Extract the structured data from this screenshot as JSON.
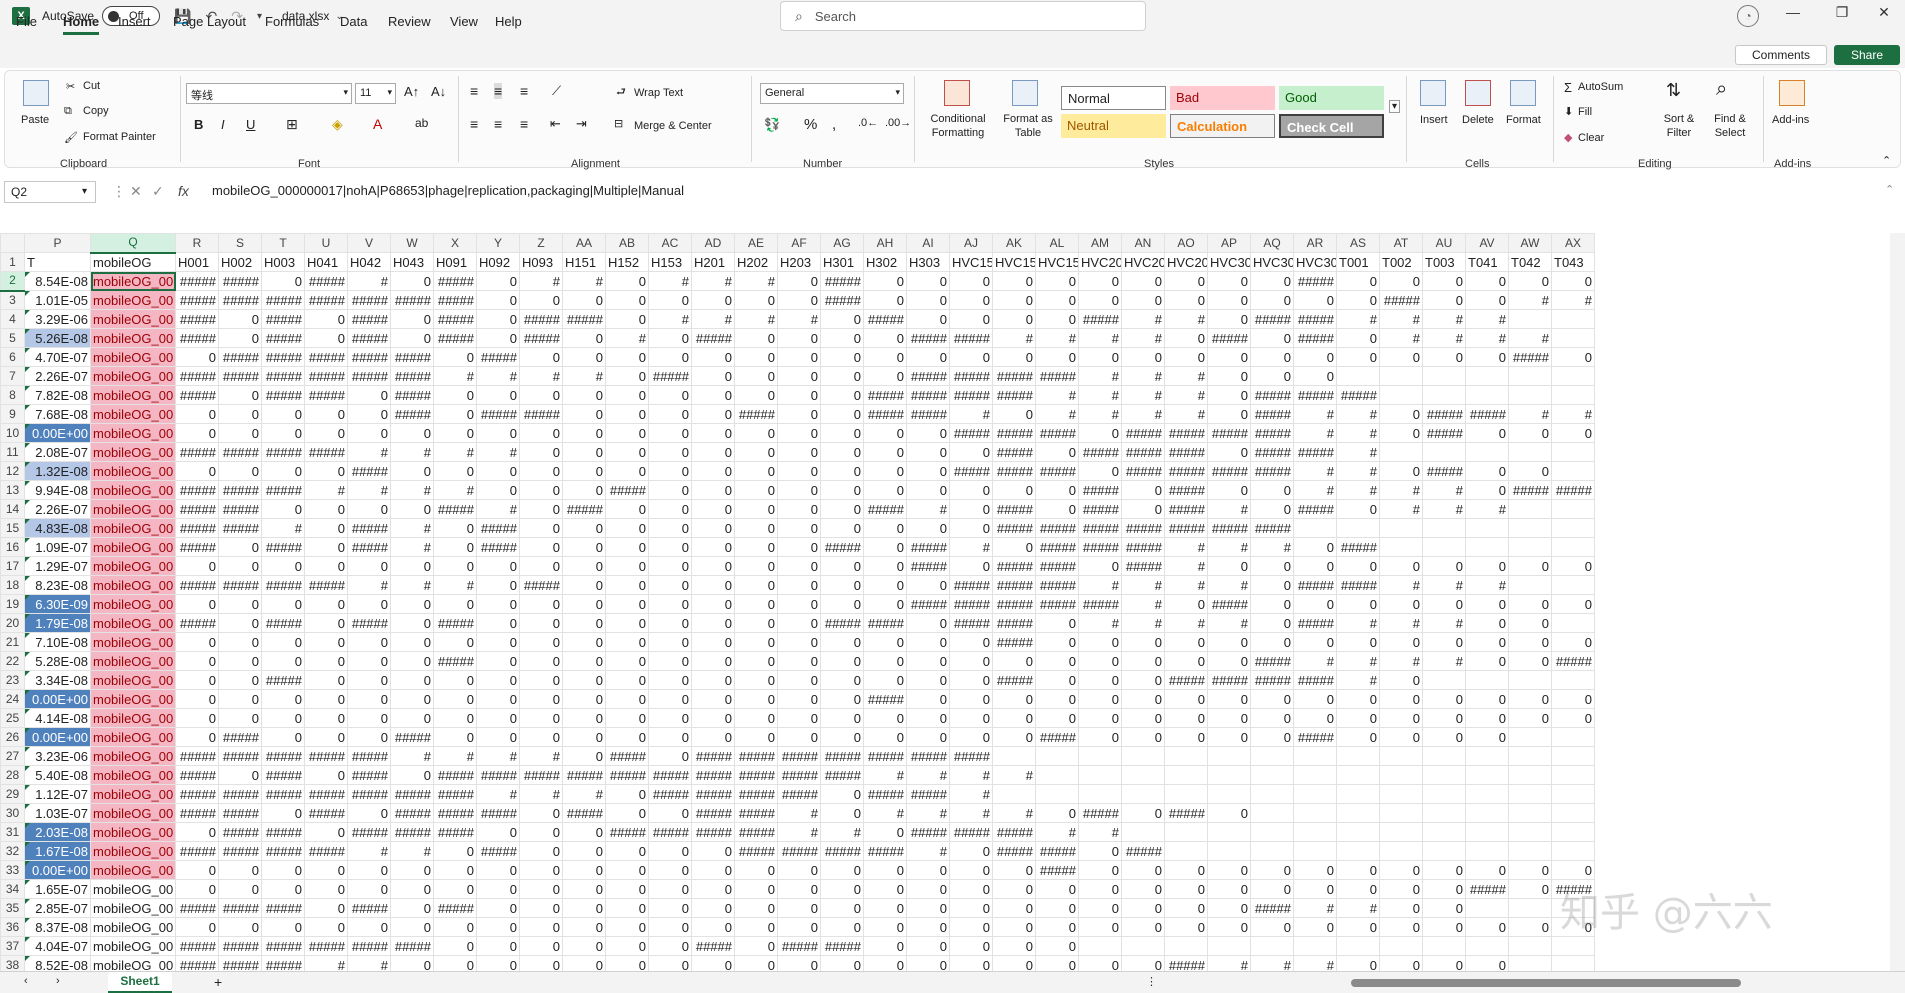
{
  "titlebar": {
    "autosave_label": "AutoSave",
    "autosave_state": "Off",
    "filename": "data.xlsx",
    "search_placeholder": "Search"
  },
  "menu": {
    "tabs": [
      "File",
      "Home",
      "Insert",
      "Page Layout",
      "Formulas",
      "Data",
      "Review",
      "View",
      "Help"
    ],
    "active": "Home",
    "comments_label": "Comments",
    "share_label": "Share"
  },
  "ribbon": {
    "clipboard": {
      "paste": "Paste",
      "cut": "Cut",
      "copy": "Copy",
      "format_painter": "Format Painter",
      "label": "Clipboard"
    },
    "font": {
      "name": "等线",
      "size": "11",
      "label": "Font"
    },
    "alignment": {
      "wrap_text": "Wrap Text",
      "merge_center": "Merge & Center",
      "label": "Alignment"
    },
    "number": {
      "format": "General",
      "label": "Number"
    },
    "styles": {
      "conditional": "Conditional Formatting",
      "format_table": "Format as Table",
      "normal": "Normal",
      "bad": "Bad",
      "good": "Good",
      "neutral": "Neutral",
      "calculation": "Calculation",
      "check_cell": "Check Cell",
      "label": "Styles"
    },
    "cells": {
      "insert": "Insert",
      "delete": "Delete",
      "format": "Format",
      "label": "Cells"
    },
    "editing": {
      "autosum": "AutoSum",
      "fill": "Fill",
      "clear": "Clear",
      "sort_filter": "Sort & Filter",
      "find_select": "Find & Select",
      "label": "Editing"
    },
    "addins": {
      "addins": "Add-ins",
      "label": "Add-ins"
    }
  },
  "formula_bar": {
    "name_box": "Q2",
    "formula": "mobileOG_000000017|nohA|P68653|phage|replication,packaging|Multiple|Manual"
  },
  "grid": {
    "columns": [
      "P",
      "Q",
      "R",
      "S",
      "T",
      "U",
      "V",
      "W",
      "X",
      "Y",
      "Z",
      "AA",
      "AB",
      "AC",
      "AD",
      "AE",
      "AF",
      "AG",
      "AH",
      "AI",
      "AJ",
      "AK",
      "AL",
      "AM",
      "AN",
      "AO",
      "AP",
      "AQ",
      "AR",
      "AS",
      "AT",
      "AU",
      "AV",
      "AW",
      "AX"
    ],
    "selected_column": "Q",
    "header_row": [
      "T",
      "mobileOG",
      "H001",
      "H002",
      "H003",
      "H041",
      "H042",
      "H043",
      "H091",
      "H092",
      "H093",
      "H151",
      "H152",
      "H153",
      "H201",
      "H202",
      "H203",
      "H301",
      "H302",
      "H303",
      "HVC151",
      "HVC152",
      "HVC153",
      "HVC201",
      "HVC202",
      "HVC203",
      "HVC301",
      "HVC302",
      "HVC303",
      "T001",
      "T002",
      "T003",
      "T041",
      "T042",
      "T043"
    ],
    "og_text": "mobileOG_00",
    "pvalues": [
      "8.54E-08",
      "1.01E-05",
      "3.29E-06",
      "5.26E-08",
      "4.70E-07",
      "2.26E-07",
      "7.82E-08",
      "7.68E-08",
      "0.00E+00",
      "2.08E-07",
      "1.32E-08",
      "9.94E-08",
      "2.26E-07",
      "4.83E-08",
      "1.09E-07",
      "1.29E-07",
      "8.23E-08",
      "6.30E-09",
      "1.79E-08",
      "7.10E-08",
      "5.28E-08",
      "3.34E-08",
      "0.00E+00",
      "4.14E-08",
      "0.00E+00",
      "3.23E-06",
      "5.40E-08",
      "1.12E-07",
      "1.03E-07",
      "2.03E-08",
      "1.67E-08",
      "0.00E+00",
      "1.65E-07",
      "2.85E-07",
      "8.37E-08",
      "4.04E-07",
      "8.52E-08"
    ],
    "pvalue_highlight": [
      "",
      "",
      "",
      "lblue",
      "",
      "",
      "",
      "",
      "blue",
      "",
      "lblue",
      "",
      "",
      "lblue",
      "",
      "",
      "",
      "blue",
      "blue",
      "",
      "",
      "",
      "blue",
      "",
      "blue",
      "",
      "",
      "",
      "",
      "blue",
      "blue",
      "blue",
      "",
      "",
      "",
      "",
      ""
    ],
    "pink_rows": 32,
    "hash": "#####",
    "zero": "0",
    "cells": [
      "##########0######0#####0##0###0#####0000000000#####00000000#####0#####",
      "###################################00000000#####000000000000#####00###",
      "#####0#####0#####0#####0##########0####0#####0000#######0##############",
      "#####0#####0#####0#####0#####0#0#####0000##############0#####0#####0####",
      "0#########################0#####00000000000000000000000#####0#######",
      "##################################0#####00000#######################000",
      "#####0##########0#####0000000000########################0###############",
      "00000#####0##########0000#####00###########0####0#######0##############",
      "000000000000000000###############0######################0#####00000",
      "########################00000000000#####0###############0###########",
      "0000#####0000000000000###############0######################0#####00",
      "###################000#####0000000000#####0#####00####0###########00",
      "##########0000######0#####000000######0#####0#####0######0#####0###",
      "###########0######0#####00000000000###################################",
      "#####0#####0######0#####0000000#####0######0##################0#####",
      "00000000000000000#####0##########0######000000000000000",
      "#######################0#####000000000###################0#############",
      "00000000000000000##########################0#####0000000000",
      "#####0#####0#####0#####00000000##########0##########0####0########00",
      "0000000000000000000#####00000000000000000",
      "000000#####000000000000000000#########00#####",
      "00#####0000000000000000#####000#####################0",
      "0000000000000000#####000000000000000000",
      "00000000000000000000000000000000000",
      "0#####000#####00000000000000#####00000#####0000",
      "#############################0#####0###################################",
      "#####0#####0#####0######################################################",
      "######################################0####################0###########",
      "##########0#####0###############0#####00###########0####0#####0#####0",
      "0##########0###############000######################0#################",
      "######################0#####00000#####################0##########0#####",
      "00000000000000000000#####00000000000000",
      "000000000000000000000000000000#####0#####0#####",
      "###############0#####0#####000000000000000000#######00",
      "00000000000000000000000000000000000",
      "##############################000000#####0##########00000",
      "#################000000000000000000########0000"
    ]
  },
  "sheets": {
    "active": "Sheet1"
  },
  "watermark": "知乎 @六六"
}
